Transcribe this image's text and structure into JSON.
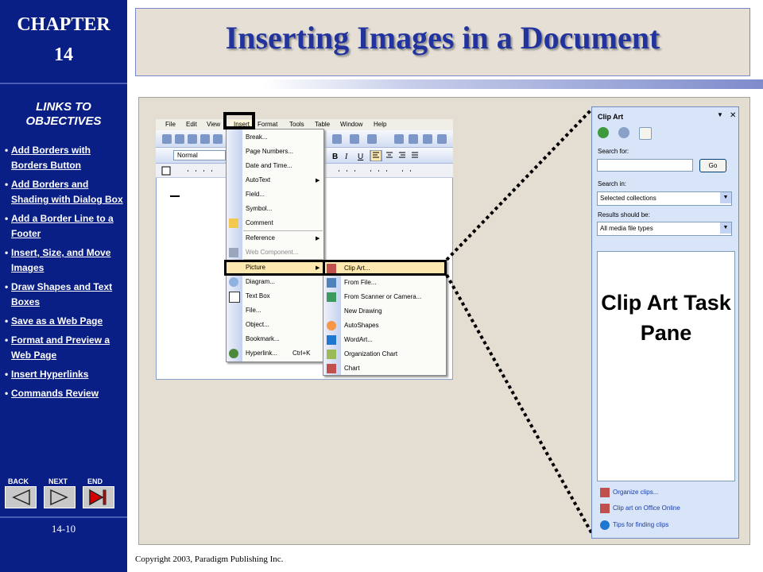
{
  "sidebar": {
    "chapter": "CHAPTER",
    "chapter_number": "14",
    "links_title": "LINKS TO OBJECTIVES",
    "links": [
      "Add Borders with Borders Button",
      "Add Borders and Shading with Dialog Box",
      "Add a Border Line to a Footer",
      "Insert, Size, and Move Images",
      "Draw Shapes and Text Boxes",
      "Save as a Web Page",
      "Format and Preview a Web Page",
      "Insert Hyperlinks",
      "Commands Review"
    ],
    "nav": {
      "back": "BACK",
      "next": "NEXT",
      "end": "END"
    },
    "page_number": "14-10"
  },
  "slide": {
    "title": "Inserting Images in a Document",
    "copyright": "Copyright 2003, Paradigm Publishing Inc."
  },
  "word": {
    "menu": [
      "File",
      "Edit",
      "View",
      "Insert",
      "Format",
      "Tools",
      "Table",
      "Window",
      "Help"
    ],
    "style_value": "Normal",
    "insert_menu": [
      "Break...",
      "Page Numbers...",
      "Date and Time...",
      "AutoText",
      "Field...",
      "Symbol...",
      "Comment",
      "Reference",
      "Web Component...",
      "Picture",
      "Diagram...",
      "Text Box",
      "File...",
      "Object...",
      "Bookmark...",
      "Hyperlink...",
      "Ctrl+K"
    ],
    "picture_menu": [
      "Clip Art...",
      "From File...",
      "From Scanner or Camera...",
      "New Drawing",
      "AutoShapes",
      "WordArt...",
      "Organization Chart",
      "Chart"
    ]
  },
  "pane": {
    "title": "Clip Art",
    "search_for": "Search for:",
    "go": "Go",
    "search_in": "Search in:",
    "search_in_value": "Selected collections",
    "results_label": "Results should be:",
    "results_value": "All media file types",
    "overlay_label": "Clip Art Task Pane",
    "links": [
      "Organize clips...",
      "Clip art on Office Online",
      "Tips for finding clips"
    ]
  },
  "colors": {
    "sidebar": "#0a1f86",
    "title": "#22339e",
    "menu_highlight": "#fde9b0"
  }
}
